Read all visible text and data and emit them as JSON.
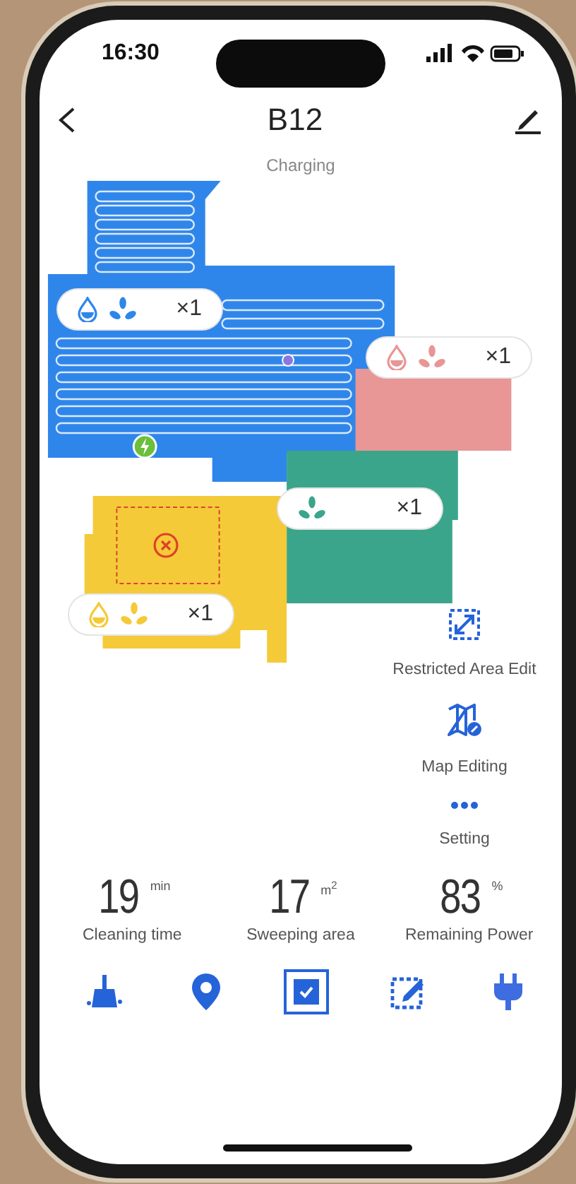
{
  "status_bar": {
    "time": "16:30"
  },
  "header": {
    "title": "B12"
  },
  "status": "Charging",
  "map": {
    "rooms": [
      {
        "color": "#2f86ea",
        "mop": true,
        "count": "×1"
      },
      {
        "color": "#e89696",
        "mop": true,
        "count": "×1"
      },
      {
        "color": "#3aa58a",
        "mop": false,
        "count": "×1"
      },
      {
        "color": "#f5ca38",
        "mop": true,
        "count": "×1"
      }
    ]
  },
  "actions": [
    {
      "label": "Restricted Area Edit"
    },
    {
      "label": "Map Editing"
    },
    {
      "label": "Setting"
    }
  ],
  "stats": [
    {
      "value": "19",
      "unit": "min",
      "label": "Cleaning time"
    },
    {
      "value": "17",
      "unit": "m$^{2}$",
      "label": "Sweeping area"
    },
    {
      "value": "83",
      "unit": "%",
      "label": "Remaining Power"
    }
  ],
  "nav": [
    {
      "selected": false
    },
    {
      "selected": false
    },
    {
      "selected": true
    },
    {
      "selected": false
    },
    {
      "selected": false
    }
  ]
}
